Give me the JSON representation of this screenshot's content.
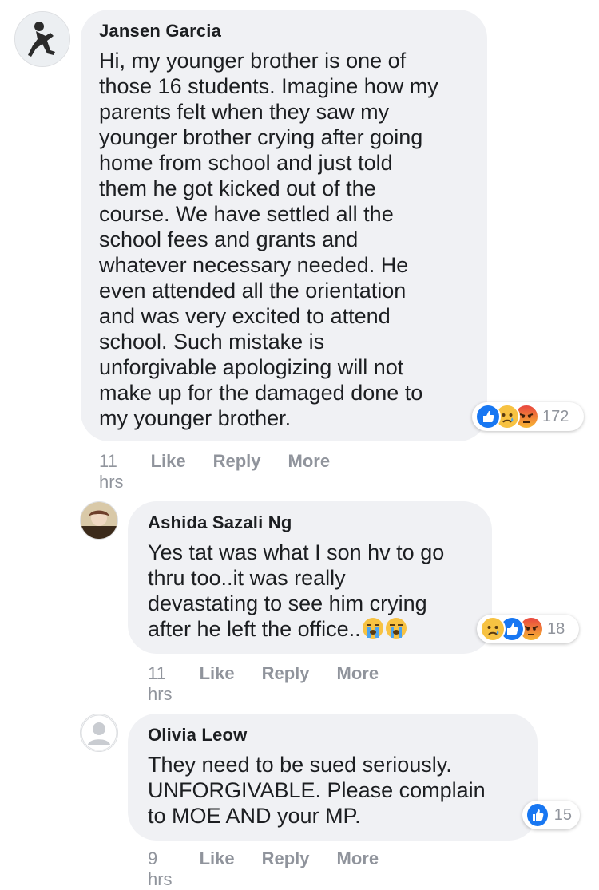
{
  "comments": [
    {
      "author": "Jansen Garcia",
      "text": "Hi, my younger brother is one of\nthose 16 students. Imagine how my\nparents felt when they saw my\nyounger brother crying after going\nhome from school and just told\nthem he got kicked out of the\ncourse. We have settled all the\nschool fees and grants and\nwhatever necessary needed. He\neven attended all the orientation\nand was very excited to attend\nschool. Such mistake is\nunforgivable apologizing will not\nmake up for the damaged done to\nmy younger brother.",
      "reactions": [
        "like",
        "sad",
        "angry"
      ],
      "reaction_count": "172",
      "time": "11 hrs",
      "like_label": "Like",
      "reply_label": "Reply",
      "more_label": "More"
    },
    {
      "author": "Ashida Sazali Ng",
      "text": "Yes tat was what I son hv to go\nthru too..it was really\ndevastating to see him crying\nafter he left the office..",
      "trailing_emoji": [
        "crying-face-icon",
        "crying-face-icon"
      ],
      "reactions": [
        "sad",
        "like",
        "angry"
      ],
      "reaction_count": "18",
      "time": "11 hrs",
      "like_label": "Like",
      "reply_label": "Reply",
      "more_label": "More"
    },
    {
      "author": "Olivia Leow",
      "text": "They need to be sued seriously.\nUNFORGIVABLE. Please complain\nto MOE AND your MP.",
      "reactions": [
        "like"
      ],
      "reaction_count": "15",
      "time": "9 hrs",
      "like_label": "Like",
      "reply_label": "Reply",
      "more_label": "More"
    }
  ],
  "colors": {
    "bubble": "#f0f1f4",
    "meta_text": "#90949c",
    "like_blue": "#1877f2",
    "angry_red": "#e9710f",
    "sad_yellow": "#f7c242"
  }
}
